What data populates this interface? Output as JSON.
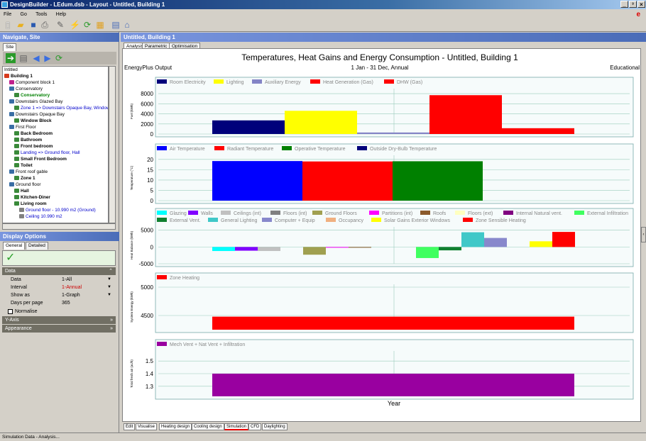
{
  "window": {
    "title": "DesignBuilder - LEdum.dsb - Layout - Untitled, Building 1",
    "controls": [
      "_",
      "³",
      "×"
    ]
  },
  "menu": [
    "File",
    "Go",
    "Tools",
    "Help"
  ],
  "toolbar_icons": [
    "new-icon",
    "open-icon",
    "save-icon",
    "print-icon",
    "wrench-icon",
    "chart-tool-icon",
    "refresh-icon",
    "building-icon",
    "export-icon",
    "model-icon"
  ],
  "nav": {
    "header": "Navigate, Site",
    "tab": "Site",
    "tree": [
      {
        "label": "Intitled",
        "indent": 0,
        "bold": false,
        "color": "#000000",
        "icon": ""
      },
      {
        "label": "Building 1",
        "indent": 0,
        "bold": true,
        "color": "#000000",
        "icon": "#d63a1c"
      },
      {
        "label": "Component block 1",
        "indent": 1,
        "bold": false,
        "color": "#000000",
        "icon": "#c0208c"
      },
      {
        "label": "Conservatory",
        "indent": 1,
        "bold": false,
        "color": "#000000",
        "icon": "#3a6ea5"
      },
      {
        "label": "Conservatory",
        "indent": 2,
        "bold": true,
        "color": "#008000",
        "icon": "#3a8a3a"
      },
      {
        "label": "Downstairs Glazed Bay",
        "indent": 1,
        "bold": false,
        "color": "#000000",
        "icon": "#3a6ea5"
      },
      {
        "label": "Zone 1 => Downstairs Opaque Bay, Window B",
        "indent": 2,
        "bold": false,
        "color": "#0000cc",
        "icon": "#3a8a3a"
      },
      {
        "label": "Downstairs Opaque Bay",
        "indent": 1,
        "bold": false,
        "color": "#000000",
        "icon": "#3a6ea5"
      },
      {
        "label": "Window Block",
        "indent": 2,
        "bold": true,
        "color": "#000000",
        "icon": "#3a8a3a"
      },
      {
        "label": "First Floor",
        "indent": 1,
        "bold": false,
        "color": "#000000",
        "icon": "#3a6ea5"
      },
      {
        "label": "Back Bedroom",
        "indent": 2,
        "bold": true,
        "color": "#000000",
        "icon": "#3a8a3a"
      },
      {
        "label": "Bathroom",
        "indent": 2,
        "bold": true,
        "color": "#000000",
        "icon": "#3a8a3a"
      },
      {
        "label": "Front bedroom",
        "indent": 2,
        "bold": true,
        "color": "#000000",
        "icon": "#3a8a3a"
      },
      {
        "label": "Landing => Ground floor, Hall",
        "indent": 2,
        "bold": false,
        "color": "#0000cc",
        "icon": "#3a8a3a"
      },
      {
        "label": "Small Front Bedroom",
        "indent": 2,
        "bold": true,
        "color": "#000000",
        "icon": "#3a8a3a"
      },
      {
        "label": "Toilet",
        "indent": 2,
        "bold": true,
        "color": "#000000",
        "icon": "#3a8a3a"
      },
      {
        "label": "Front roof gable",
        "indent": 1,
        "bold": false,
        "color": "#000000",
        "icon": "#3a6ea5"
      },
      {
        "label": "Zone 1",
        "indent": 2,
        "bold": true,
        "color": "#000000",
        "icon": "#3a8a3a"
      },
      {
        "label": "Ground floor",
        "indent": 1,
        "bold": false,
        "color": "#000000",
        "icon": "#3a6ea5"
      },
      {
        "label": "Hall",
        "indent": 2,
        "bold": true,
        "color": "#000000",
        "icon": "#3a8a3a"
      },
      {
        "label": "Kitchen-Diner",
        "indent": 2,
        "bold": true,
        "color": "#000000",
        "icon": "#3a8a3a"
      },
      {
        "label": "Living room",
        "indent": 2,
        "bold": true,
        "color": "#000000",
        "icon": "#3a8a3a"
      },
      {
        "label": "Ground floor - 10.990 m2 (Ground)",
        "indent": 3,
        "bold": false,
        "color": "#0000cc",
        "icon": "#808080"
      },
      {
        "label": "Ceiling 10.990 m2",
        "indent": 3,
        "bold": false,
        "color": "#0000cc",
        "icon": "#808080"
      }
    ]
  },
  "display_options": {
    "header": "Display Options",
    "tabs": [
      "General",
      "Detailed"
    ],
    "data_section": "Data",
    "rows": [
      {
        "label": "Data",
        "value": "1-All",
        "value_color": "#000000"
      },
      {
        "label": "Interval",
        "value": "1-Annual",
        "value_color": "#cc0000"
      },
      {
        "label": "Show as",
        "value": "1-Graph",
        "value_color": "#000000"
      },
      {
        "label": "Days per page",
        "value": "365",
        "value_color": "#000000"
      }
    ],
    "normalise": "Normalise",
    "yaxis_section": "Y-Axis",
    "appearance_section": "Appearance"
  },
  "main": {
    "title": "Untitled, Building 1",
    "tabs": [
      "Analysis",
      "Parametric",
      "Optimisation"
    ],
    "bottom_tabs": [
      "Edit",
      "Visualise",
      "Heating design",
      "Cooling design",
      "Simulation",
      "CFD",
      "Daylighting"
    ],
    "selected_bottom_tab": "Simulation"
  },
  "status": "Simulation Data - Analysis...",
  "report": {
    "title": "Temperatures, Heat Gains and Energy Consumption - Untitled, Building 1",
    "left": "EnergyPlus Output",
    "center": "1 Jan - 31 Dec, Annual",
    "right": "Educational",
    "xlabel": "Year"
  },
  "chart_data": [
    {
      "type": "bar",
      "ylabel": "Fuel (kWh)",
      "ylim": [
        0,
        9000
      ],
      "yticks": [
        0,
        2000,
        4000,
        6000,
        8000
      ],
      "series": [
        {
          "name": "Room Electricity",
          "color": "#00007b",
          "value": 2700
        },
        {
          "name": "Lighting",
          "color": "#ffff00",
          "value": 4600
        },
        {
          "name": "Auxiliary Energy",
          "color": "#8484c6",
          "value": 300
        },
        {
          "name": "Heat Generation (Gas)",
          "color": "#ff0000",
          "value": 7700
        },
        {
          "name": "DHW (Gas)",
          "color": "#ff0000",
          "value": 1150
        }
      ]
    },
    {
      "type": "bar",
      "ylabel": "Temperature (°C)",
      "ylim": [
        0,
        22
      ],
      "yticks": [
        0,
        5,
        10,
        15,
        20
      ],
      "series": [
        {
          "name": "Air Temperature",
          "color": "#0000ff",
          "value": 19.2
        },
        {
          "name": "Radiant Temperature",
          "color": "#ff0000",
          "value": 19.0
        },
        {
          "name": "Operative Temperature",
          "color": "#008000",
          "value": 19.1
        },
        {
          "name": "Outside Dry-Bulb Temperature",
          "color": "#00007b",
          "value": 0
        }
      ]
    },
    {
      "type": "bar",
      "ylabel": "Heat Balance (kWh)",
      "ylim": [
        -5000,
        6000
      ],
      "yticks": [
        -5000,
        0,
        5000
      ],
      "series": [
        {
          "name": "Glazing",
          "color": "#00ffff",
          "value": -1200
        },
        {
          "name": "Walls",
          "color": "#8000ff",
          "value": -1100
        },
        {
          "name": "Ceilings (int)",
          "color": "#c0c0c0",
          "value": -1200
        },
        {
          "name": "Floors (int)",
          "color": "#808080",
          "value": 0
        },
        {
          "name": "Ground Floors",
          "color": "#a0a050",
          "value": -2300
        },
        {
          "name": "Partitions (int)",
          "color": "#ff00ff",
          "value": -100
        },
        {
          "name": "Roofs",
          "color": "#8b5a2b",
          "value": -100
        },
        {
          "name": "Floors (ext)",
          "color": "#ffffc0",
          "value": 0
        },
        {
          "name": "Internal Natural vent.",
          "color": "#800080",
          "value": 0
        },
        {
          "name": "External Infiltration",
          "color": "#40ff60",
          "value": -3300
        },
        {
          "name": "External Vent.",
          "color": "#108030",
          "value": -1000
        },
        {
          "name": "General Lighting",
          "color": "#40c8c8",
          "value": 4400
        },
        {
          "name": "Computer + Equip",
          "color": "#8888cc",
          "value": 2700
        },
        {
          "name": "Occupancy",
          "color": "#f0b080",
          "value": 0
        },
        {
          "name": "Solar Gains Exterior Windows",
          "color": "#ffff00",
          "value": 1700
        },
        {
          "name": "Zone Sensible Heating",
          "color": "#ff0000",
          "value": 4500
        }
      ]
    },
    {
      "type": "bar",
      "ylabel": "System Energy (kWh)",
      "ylim": [
        4250,
        5050
      ],
      "yticks": [
        4500,
        5000
      ],
      "series": [
        {
          "name": "Zone Heating",
          "color": "#ff0000",
          "value": 4480
        }
      ]
    },
    {
      "type": "bar",
      "ylabel": "Total fresh air (ac/h)",
      "ylim": [
        1.22,
        1.58
      ],
      "yticks": [
        1.3,
        1.4,
        1.5
      ],
      "series": [
        {
          "name": "Mech Vent + Nat Vent + Infiltration",
          "color": "#9900a0",
          "value": 1.4
        }
      ]
    }
  ]
}
